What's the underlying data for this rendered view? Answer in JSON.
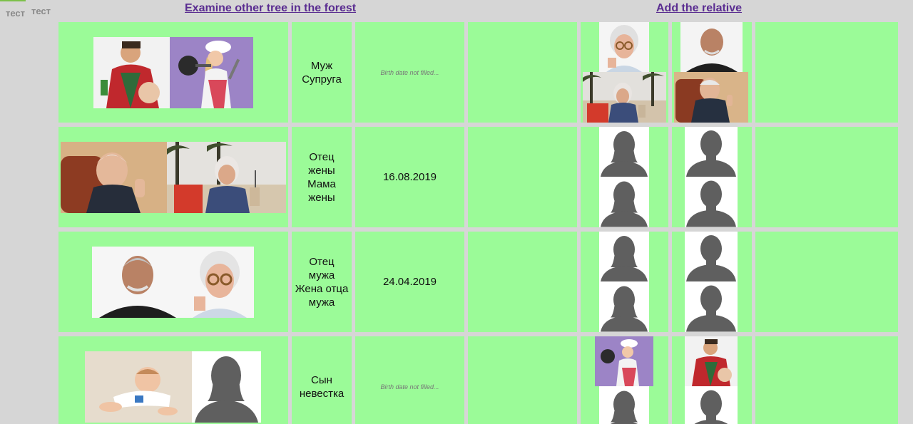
{
  "tabs": [
    {
      "label": "тест"
    },
    {
      "label": "тест"
    }
  ],
  "links": {
    "examine": "Examine other tree in the forest",
    "add_relative": "Add the relative"
  },
  "rows": [
    {
      "roles": [
        "Муж",
        "Супруга"
      ],
      "date": "Birth date not filled...",
      "date_filled": false
    },
    {
      "roles": [
        "Отец",
        "жены",
        "Мама",
        "жены"
      ],
      "date": "16.08.2019",
      "date_filled": true
    },
    {
      "roles": [
        "Отец",
        "мужа",
        "Жена отца",
        "мужа"
      ],
      "date": "24.04.2019",
      "date_filled": true
    },
    {
      "roles": [
        "Сын",
        "невестка"
      ],
      "date": "Birth date not filled...",
      "date_filled": false
    }
  ],
  "colors": {
    "background": "#d6d6d6",
    "cell": "#9bfb98",
    "link": "#5a2d91",
    "silhouette": "#5f5f5f"
  }
}
